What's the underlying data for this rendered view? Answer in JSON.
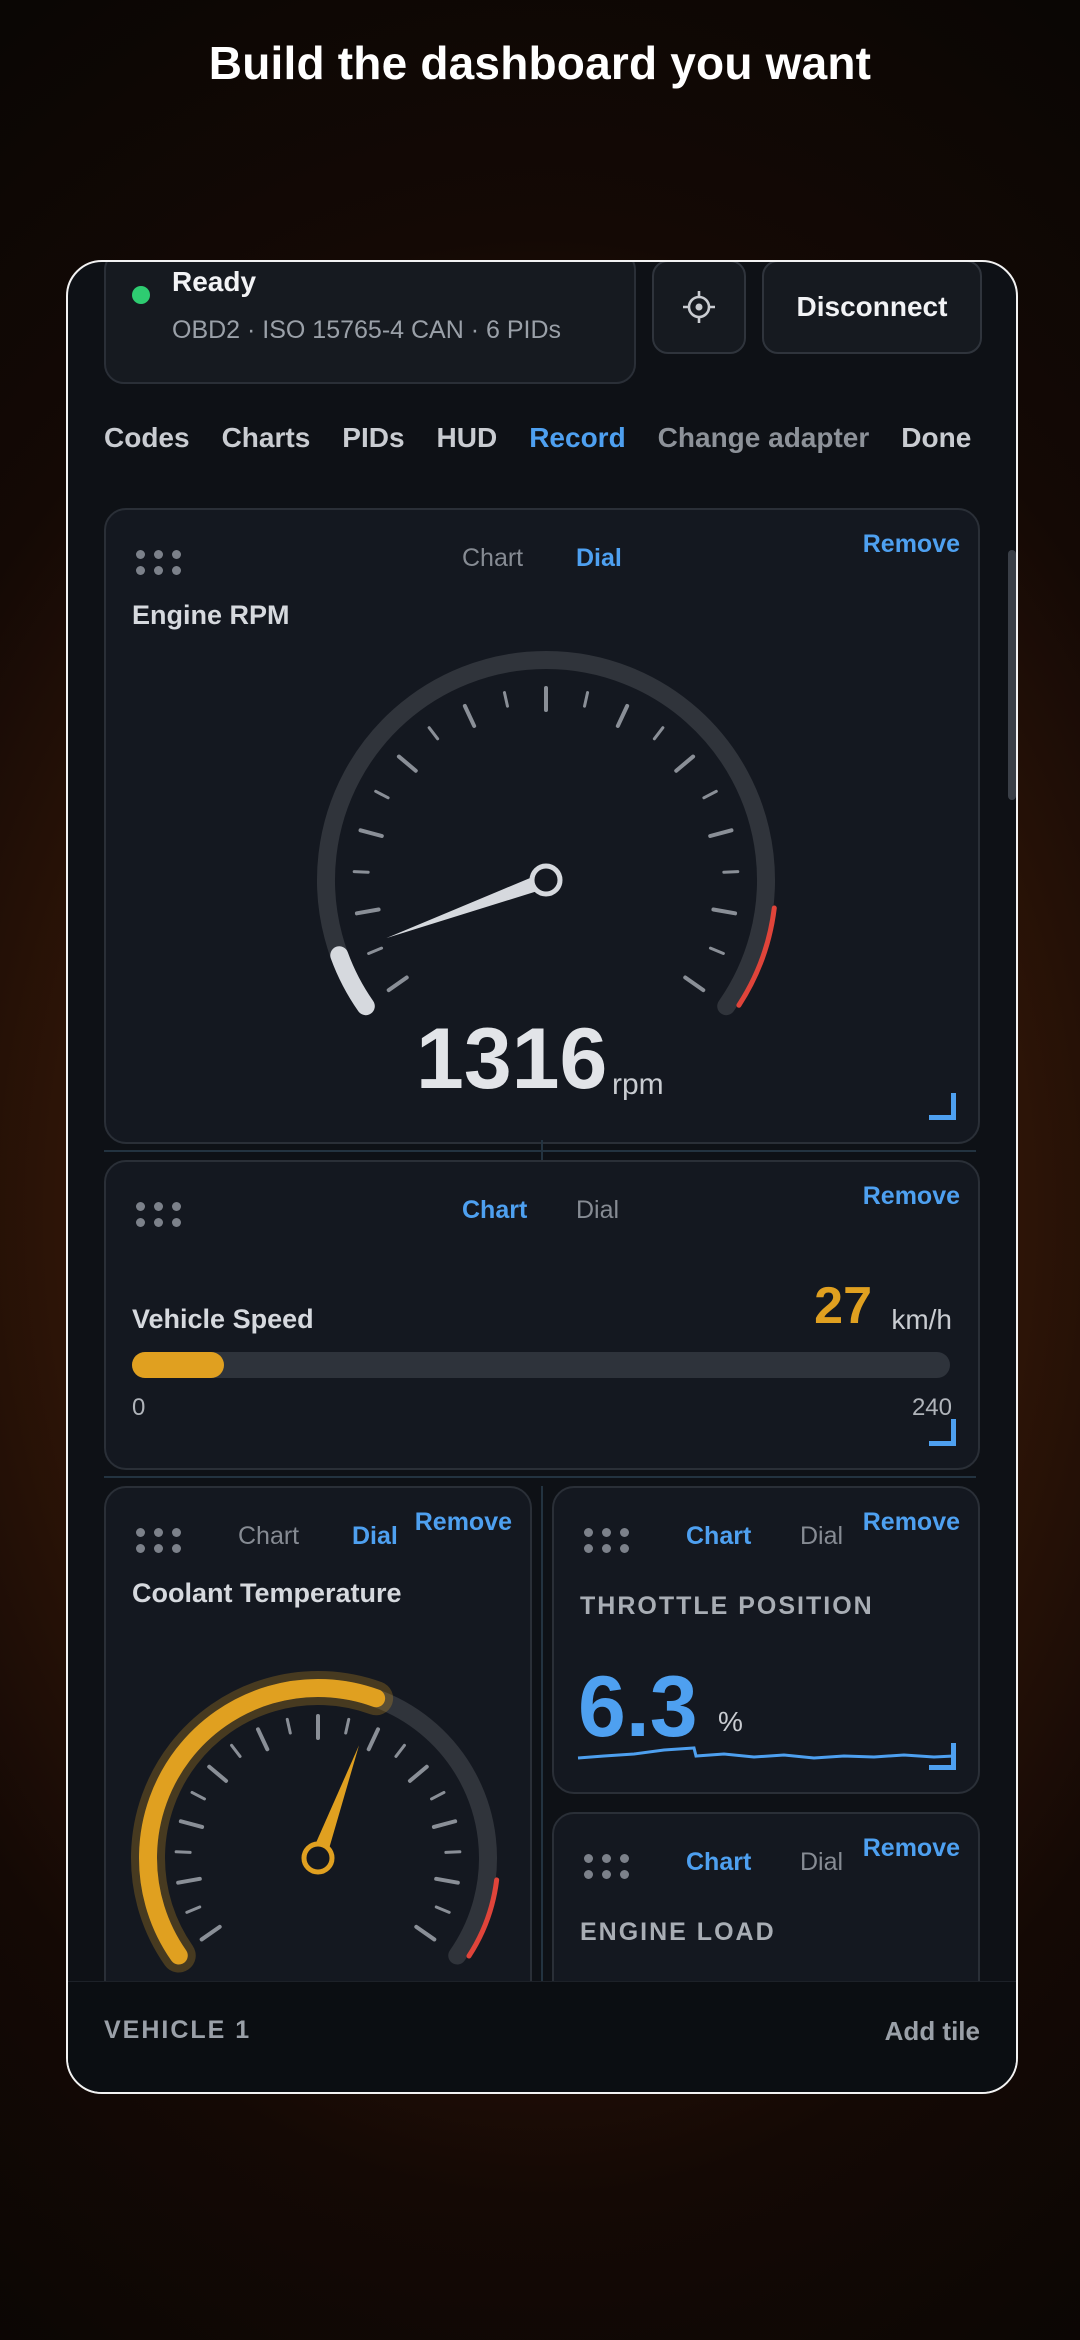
{
  "headline": "Build the dashboard you want",
  "status": {
    "title": "Ready",
    "subtitle": "OBD2 · ISO 15765-4 CAN · 6 PIDs",
    "indicator_color": "#2ecc71"
  },
  "toolbar": {
    "settings_icon": "target-icon",
    "disconnect_label": "Disconnect"
  },
  "nav": {
    "items": [
      "Codes",
      "Charts",
      "PIDs",
      "HUD",
      "Record",
      "Change adapter",
      "Done"
    ],
    "active": "Record"
  },
  "tiles": {
    "rpm": {
      "title": "Engine RPM",
      "mode_chart": "Chart",
      "mode_dial": "Dial",
      "selected_mode": "Dial",
      "remove_label": "Remove",
      "value": "1316",
      "unit": "rpm",
      "value_num": 1316,
      "max": 8000
    },
    "speed": {
      "title": "Vehicle Speed",
      "mode_chart": "Chart",
      "mode_dial": "Dial",
      "selected_mode": "Chart",
      "remove_label": "Remove",
      "value": "27",
      "unit": "km/h",
      "min_label": "0",
      "max_label": "240",
      "fraction": 0.1125
    },
    "coolant": {
      "title": "Coolant Temperature",
      "mode_chart": "Chart",
      "mode_dial": "Dial",
      "selected_mode": "Dial",
      "remove_label": "Remove",
      "fraction": 0.58
    },
    "throttle": {
      "title": "THROTTLE POSITION",
      "mode_chart": "Chart",
      "mode_dial": "Dial",
      "selected_mode": "Chart",
      "remove_label": "Remove",
      "value": "6.3",
      "unit": "%"
    },
    "load": {
      "title": "ENGINE LOAD",
      "mode_chart": "Chart",
      "mode_dial": "Dial",
      "selected_mode": "Chart",
      "remove_label": "Remove"
    }
  },
  "footer": {
    "vehicle_label": "VEHICLE 1",
    "add_tile_label": "Add tile"
  },
  "colors": {
    "accent": "#4ea0f0",
    "amber": "#e0a020",
    "redline": "#e0443a"
  }
}
